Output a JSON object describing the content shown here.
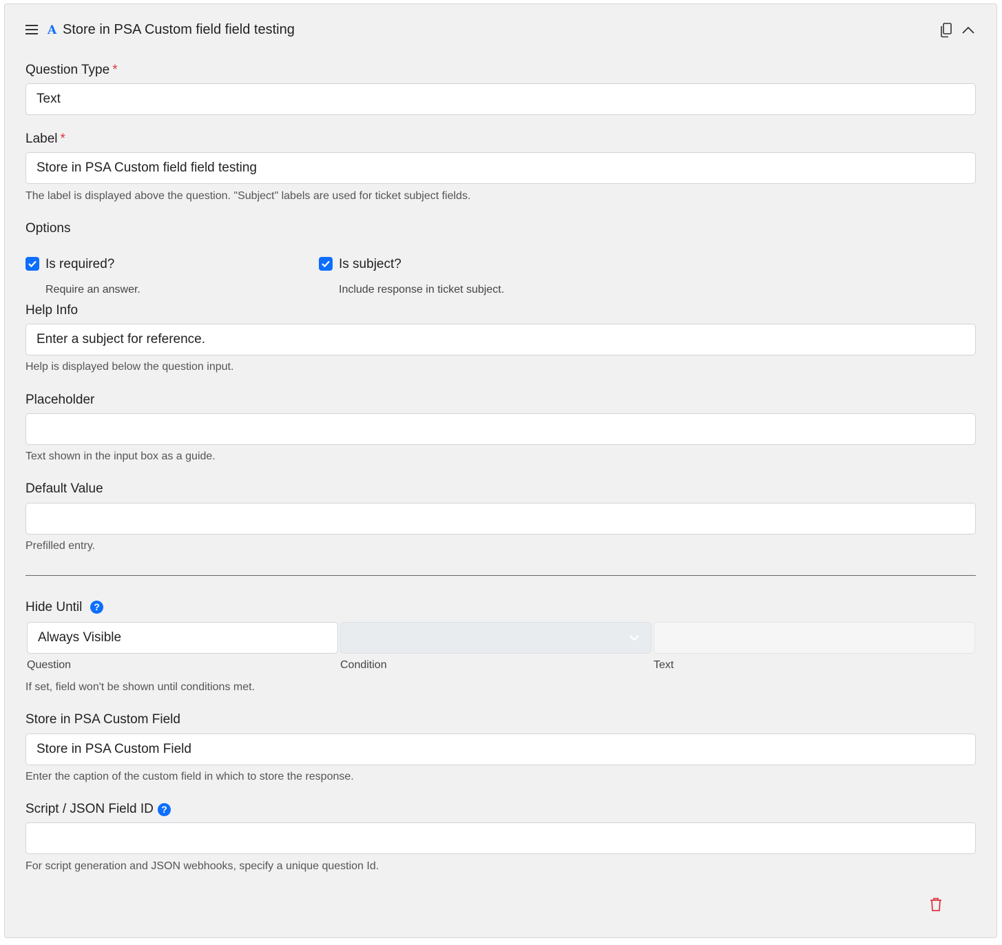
{
  "header": {
    "type_icon": "A",
    "title": "Store in PSA Custom field field testing",
    "icons": [
      "hamburger-menu-icon",
      "copy-icon",
      "chevron-up-icon"
    ]
  },
  "question_type": {
    "label": "Question Type",
    "required_mark": "*",
    "value": "Text"
  },
  "label_field": {
    "label": "Label",
    "required_mark": "*",
    "value": "Store in PSA Custom field field testing",
    "help": "The label is displayed above the question. \"Subject\" labels are used for ticket subject fields."
  },
  "options": {
    "title": "Options",
    "items": [
      {
        "label": "Is required?",
        "help": "Require an answer.",
        "checked": true
      },
      {
        "label": "Is subject?",
        "help": "Include response in ticket subject.",
        "checked": true
      }
    ]
  },
  "help_info": {
    "label": "Help Info",
    "value": "Enter a subject for reference.",
    "help": "Help is displayed below the question input."
  },
  "placeholder": {
    "label": "Placeholder",
    "value": "",
    "help": "Text shown in the input box as a guide."
  },
  "default_value": {
    "label": "Default Value",
    "value": "",
    "help": "Prefilled entry."
  },
  "hide_until": {
    "label": "Hide Until",
    "question_value": "Always Visible",
    "condition_value": "",
    "text_value": "",
    "captions": {
      "question": "Question",
      "condition": "Condition",
      "text": "Text"
    },
    "help": "If set, field won't be shown until conditions met."
  },
  "psa_field": {
    "label": "Store in PSA Custom Field",
    "value": "Store in PSA Custom Field",
    "help": "Enter the caption of the custom field in which to store the response."
  },
  "script_id": {
    "label": "Script / JSON Field ID",
    "value": "",
    "help": "For script generation and JSON webhooks, specify a unique question Id."
  },
  "colors": {
    "accent": "#0d6efd",
    "required": "#dc3545",
    "delete": "#dc3545",
    "card_bg": "#f1f1f1"
  }
}
